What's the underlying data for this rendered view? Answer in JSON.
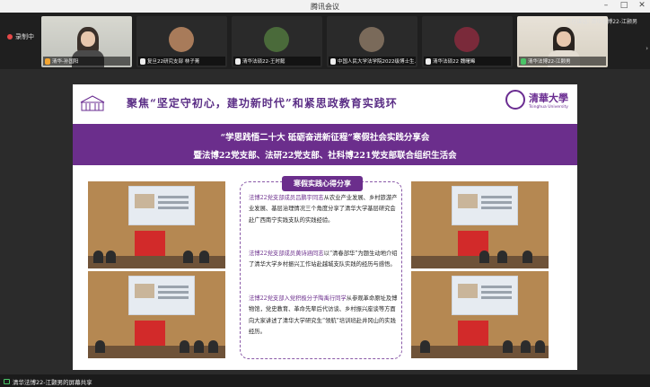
{
  "window": {
    "title": "腾讯会议",
    "controls": [
      "minimize",
      "maximize",
      "close"
    ]
  },
  "recording": {
    "label": "录制中"
  },
  "speaking": {
    "text": "正在讲话: 清华法博22-江颢男"
  },
  "participants": [
    {
      "name": "清华-孙国阳",
      "mic": "orange",
      "type": "camera"
    },
    {
      "name": "复旦22研究支部 林子菁",
      "mic": "white",
      "type": "avatar",
      "color": "#a87b5a"
    },
    {
      "name": "清华法硕22-王时懿",
      "mic": "white",
      "type": "avatar",
      "color": "#4a6a3a"
    },
    {
      "name": "中国人民大学法学院2022级博士生...",
      "mic": "white",
      "type": "avatar",
      "color": "#7a6a5a"
    },
    {
      "name": "清华法硕22 魏曙晞",
      "mic": "white",
      "type": "avatar",
      "color": "#7a2a3a"
    },
    {
      "name": "清华法博22-江颢男",
      "mic": "green",
      "type": "camera"
    }
  ],
  "slide": {
    "headline": "聚焦“坚定守初心，建功新时代”和紧思政教育实践环",
    "logo_name": "清華大學",
    "logo_en": "Tsinghua University",
    "bar_line1": "“学思践悟二十大 砥砺奋进新征程”寒假社会实践分享会",
    "bar_line2": "暨法博22党支部、法研22党支部、社科博221党支部联合组织生活会",
    "box_title": "寒假实践心得分享",
    "para1_hl": "法博22党支部成员吕鹏宇同志",
    "para1": "从农业产业发展、乡村旅游产业发展、基层治理情况三个角度分享了清华大学基层研究会赴广西南宁实践支队的实践经验。",
    "para2_hl": "法博22党支部成员黄诗涵同志",
    "para2": "以“清春部华”为题生动地介绍了清华大学乡村振兴工作站赴越城支队实践的经历与感悟。",
    "para3_hl": "法博22党支部入党积极分子陶禹行同学",
    "para3": "从参观革命原址及博物馆，党史教育、革命先辈后代访谈、乡村振兴座谈等方面向大家讲述了清华大学研究生“领航”培训班赴井冈山的实践经历。"
  },
  "share": {
    "text": "清华法博22-江颢男的屏幕共享"
  },
  "colors": {
    "accent": "#6b2e8c",
    "flag": "#d22a2a",
    "speaking": "#4ac467"
  }
}
